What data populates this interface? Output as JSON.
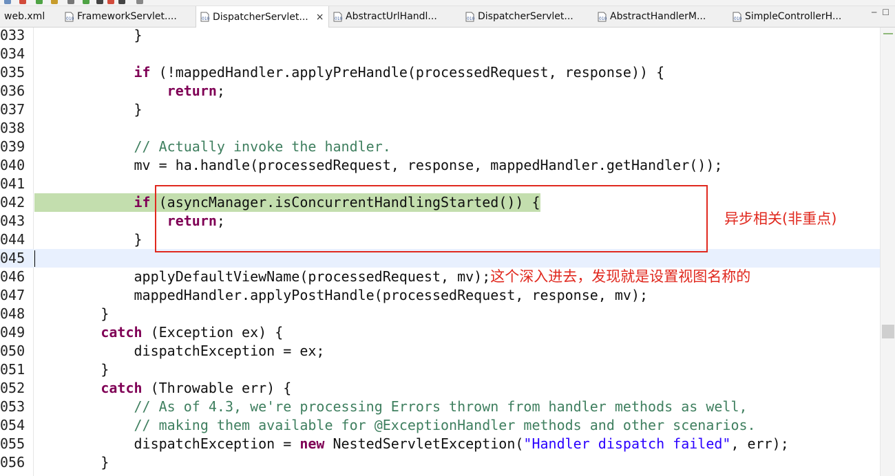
{
  "tabs": [
    {
      "label": "web.xml",
      "active": false
    },
    {
      "label": "FrameworkServlet....",
      "active": false
    },
    {
      "label": "DispatcherServlet...",
      "active": true
    },
    {
      "label": "AbstractUrlHandl...",
      "active": false
    },
    {
      "label": "DispatcherServlet...",
      "active": false
    },
    {
      "label": "AbstractHandlerM...",
      "active": false
    },
    {
      "label": "SimpleControllerH...",
      "active": false
    }
  ],
  "close_symbol": "×",
  "window_controls": {
    "minimize": "─",
    "maximize": "☐"
  },
  "colors": {
    "keyword": "#7f0055",
    "comment": "#3f7f5f",
    "string": "#2a00ff",
    "highlight": "#c3deae",
    "annotation": "#e0281e"
  },
  "editor": {
    "lines": [
      {
        "n": "033",
        "segs": [
          {
            "t": "            }"
          }
        ]
      },
      {
        "n": "034",
        "segs": [
          {
            "t": ""
          }
        ]
      },
      {
        "n": "035",
        "segs": [
          {
            "t": "            "
          },
          {
            "t": "if",
            "c": "kw"
          },
          {
            "t": " (!mappedHandler.applyPreHandle(processedRequest, response)) {"
          }
        ]
      },
      {
        "n": "036",
        "segs": [
          {
            "t": "                "
          },
          {
            "t": "return",
            "c": "kw"
          },
          {
            "t": ";"
          }
        ]
      },
      {
        "n": "037",
        "segs": [
          {
            "t": "            }"
          }
        ]
      },
      {
        "n": "038",
        "segs": [
          {
            "t": ""
          }
        ]
      },
      {
        "n": "039",
        "segs": [
          {
            "t": "            "
          },
          {
            "t": "// Actually invoke the handler.",
            "c": "cm"
          }
        ]
      },
      {
        "n": "040",
        "segs": [
          {
            "t": "            mv = ha.handle(processedRequest, response, mappedHandler.getHandler());"
          }
        ]
      },
      {
        "n": "041",
        "segs": [
          {
            "t": ""
          }
        ]
      },
      {
        "n": "042",
        "hl": "green",
        "segs": [
          {
            "t": "            "
          },
          {
            "t": "if",
            "c": "kw"
          },
          {
            "t": " (asyncManager.isConcurrentHandlingStarted()) {"
          }
        ]
      },
      {
        "n": "043",
        "segs": [
          {
            "t": "                "
          },
          {
            "t": "return",
            "c": "kw"
          },
          {
            "t": ";"
          }
        ]
      },
      {
        "n": "044",
        "segs": [
          {
            "t": "            }"
          }
        ]
      },
      {
        "n": "045",
        "hl": "cur",
        "segs": [
          {
            "t": ""
          }
        ]
      },
      {
        "n": "046",
        "segs": [
          {
            "t": "            applyDefaultViewName(processedRequest, mv);"
          },
          {
            "t": "这个深入进去，发现就是设置视图名称的",
            "c": "cjk"
          }
        ]
      },
      {
        "n": "047",
        "segs": [
          {
            "t": "            mappedHandler.applyPostHandle(processedRequest, response, mv);"
          }
        ]
      },
      {
        "n": "048",
        "segs": [
          {
            "t": "        }"
          }
        ]
      },
      {
        "n": "049",
        "segs": [
          {
            "t": "        "
          },
          {
            "t": "catch",
            "c": "kw"
          },
          {
            "t": " (Exception ex) {"
          }
        ]
      },
      {
        "n": "050",
        "segs": [
          {
            "t": "            dispatchException = ex;"
          }
        ]
      },
      {
        "n": "051",
        "segs": [
          {
            "t": "        }"
          }
        ]
      },
      {
        "n": "052",
        "segs": [
          {
            "t": "        "
          },
          {
            "t": "catch",
            "c": "kw"
          },
          {
            "t": " (Throwable err) {"
          }
        ]
      },
      {
        "n": "053",
        "segs": [
          {
            "t": "            "
          },
          {
            "t": "// As of 4.3, we're processing Errors thrown from handler methods as well,",
            "c": "cm"
          }
        ]
      },
      {
        "n": "054",
        "segs": [
          {
            "t": "            "
          },
          {
            "t": "// making them available for @ExceptionHandler methods and other scenarios.",
            "c": "cm"
          }
        ]
      },
      {
        "n": "055",
        "segs": [
          {
            "t": "            dispatchException = "
          },
          {
            "t": "new",
            "c": "kw"
          },
          {
            "t": " NestedServletException("
          },
          {
            "t": "\"Handler dispatch failed\"",
            "c": "str"
          },
          {
            "t": ", err);"
          }
        ]
      },
      {
        "n": "056",
        "segs": [
          {
            "t": "        }"
          }
        ]
      }
    ]
  },
  "annotation": {
    "text": "异步相关(非重点)"
  }
}
